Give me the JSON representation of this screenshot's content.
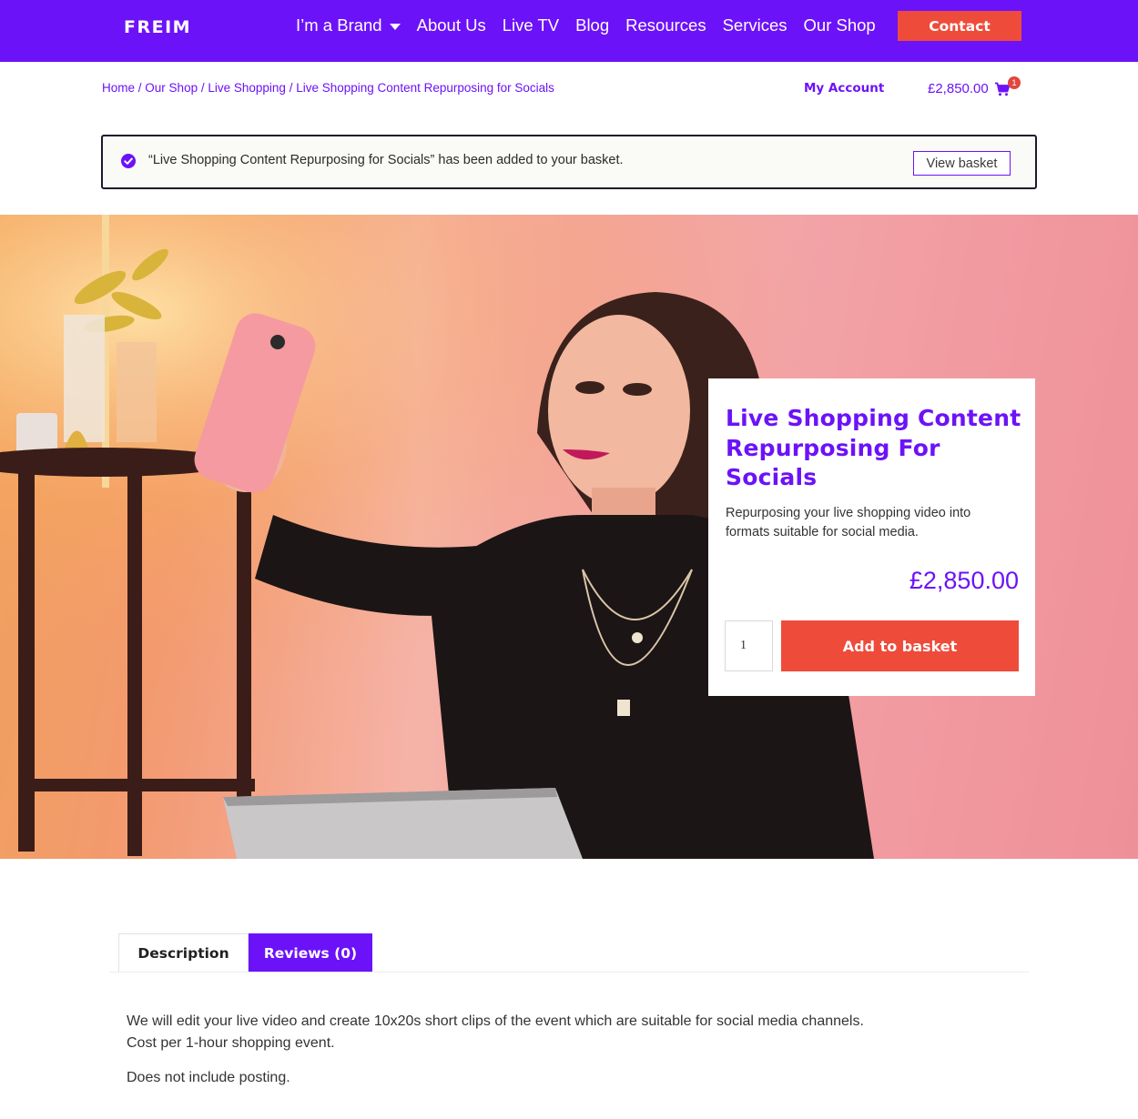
{
  "header": {
    "logo": "FREIM",
    "nav": [
      {
        "label": "I’m a Brand",
        "has_dropdown": true
      },
      {
        "label": "About Us"
      },
      {
        "label": "Live TV"
      },
      {
        "label": "Blog"
      },
      {
        "label": "Resources"
      },
      {
        "label": "Services"
      },
      {
        "label": "Our Shop"
      }
    ],
    "contact_label": "Contact"
  },
  "breadcrumb": {
    "items": [
      "Home",
      "Our Shop",
      "Live Shopping",
      "Live Shopping Content Repurposing for Socials"
    ],
    "separator": "/"
  },
  "account": {
    "my_account_label": "My Account",
    "cart_total": "£2,850.00",
    "cart_count": "1"
  },
  "notice": {
    "message": "“Live Shopping Content Repurposing for Socials” has been added to your basket.",
    "view_basket_label": "View basket"
  },
  "product": {
    "title": "Live Shopping Content Repurposing For Socials",
    "short_description": "Repurposing your live shopping video into formats suitable for social media.",
    "price": "£2,850.00",
    "quantity": "1",
    "add_to_basket_label": "Add to basket"
  },
  "tabs": [
    {
      "label": "Description",
      "active": false
    },
    {
      "label": "Reviews (0)",
      "active": true
    }
  ],
  "description": {
    "paragraph_1_line_1": "We will edit your live video and create 10x20s short clips of the event which are suitable for social media channels.",
    "paragraph_1_line_2": "Cost per 1-hour shopping event.",
    "paragraph_2": "Does not include posting."
  },
  "colors": {
    "brand_purple": "#6c12f8",
    "accent_red": "#ef4b3b"
  }
}
